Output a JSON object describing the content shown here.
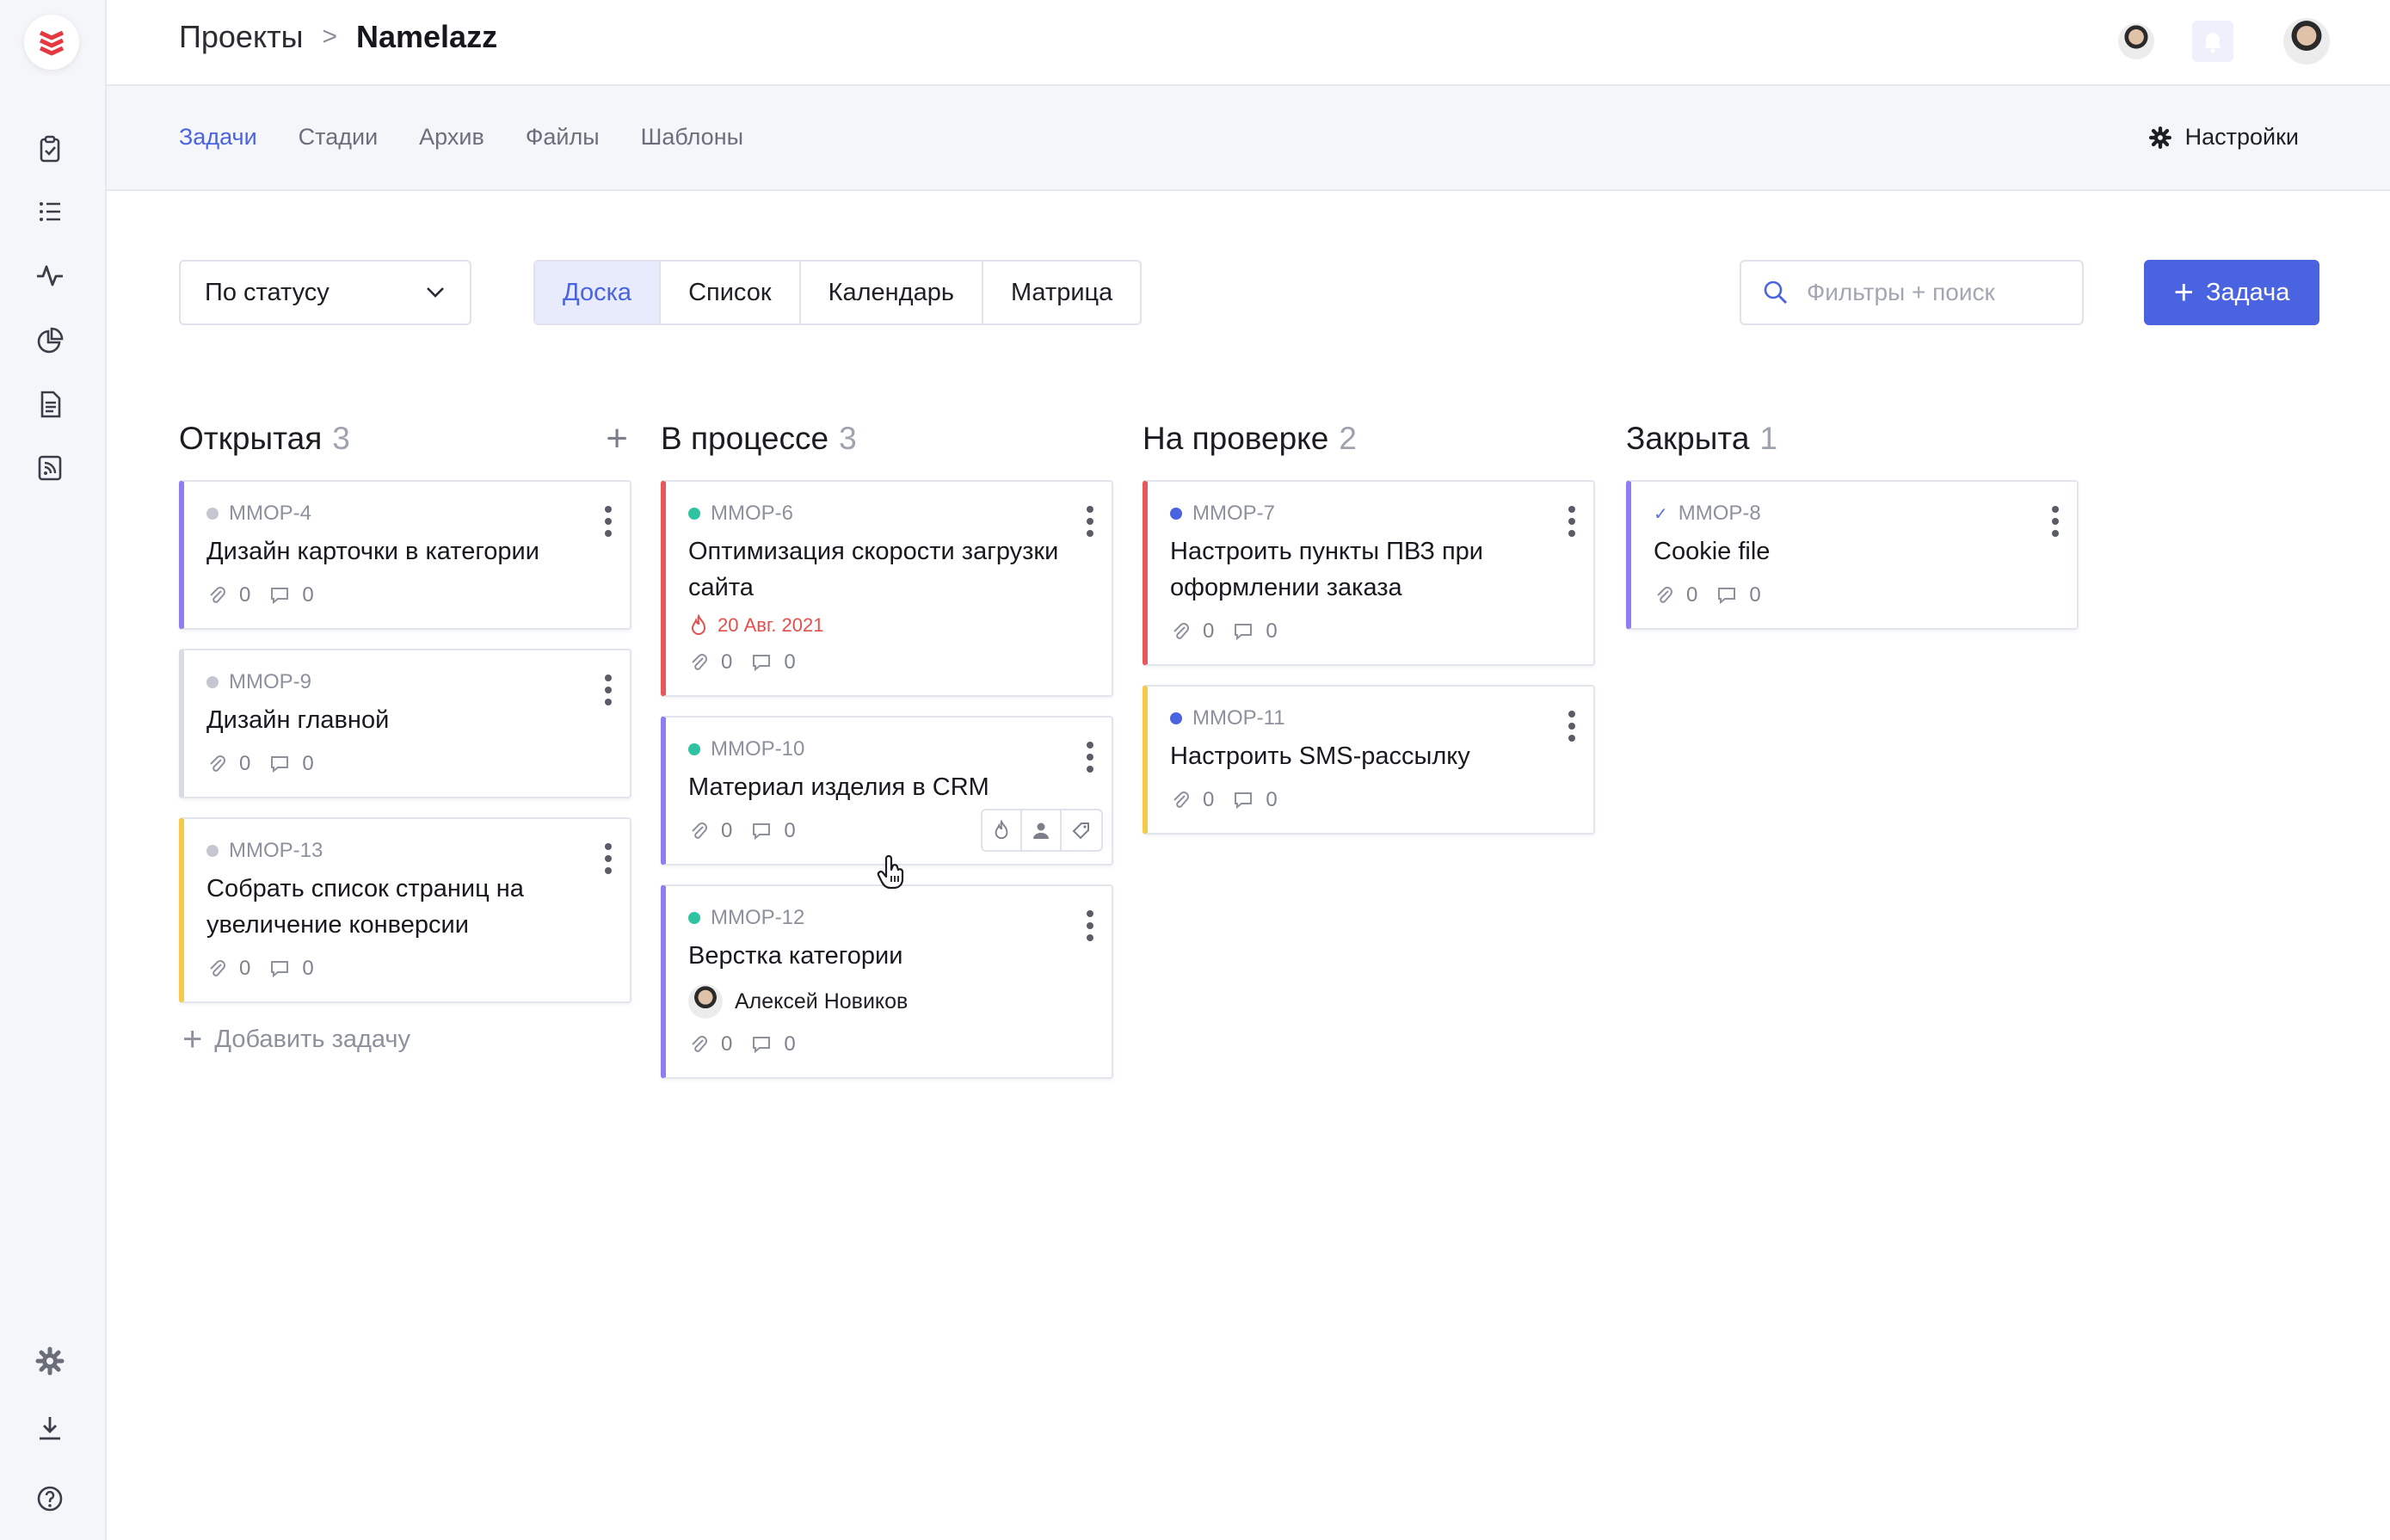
{
  "header": {
    "breadcrumb_root": "Проекты",
    "breadcrumb_separator": ">",
    "project_name": "Namelazz"
  },
  "subnav": {
    "tabs": [
      {
        "label": "Задачи",
        "active": true
      },
      {
        "label": "Стадии",
        "active": false
      },
      {
        "label": "Архив",
        "active": false
      },
      {
        "label": "Файлы",
        "active": false
      },
      {
        "label": "Шаблоны",
        "active": false
      }
    ],
    "settings_label": "Настройки"
  },
  "sidebar": {
    "icons": [
      "tasks-clipboard-icon",
      "list-icon",
      "activity-icon",
      "reports-pie-icon",
      "document-icon",
      "feed-icon",
      "settings-gear-icon",
      "download-icon",
      "help-icon"
    ]
  },
  "toolbar": {
    "group_select": "По статусу",
    "views": [
      {
        "label": "Доска",
        "active": true
      },
      {
        "label": "Список",
        "active": false
      },
      {
        "label": "Календарь",
        "active": false
      },
      {
        "label": "Матрица",
        "active": false
      }
    ],
    "search_placeholder": "Фильтры + поиск",
    "add_task_label": "Задача"
  },
  "colors": {
    "accent": "#4a63e0",
    "purple": "#8e7ff0",
    "red": "#e8585a",
    "yellow": "#f5c949",
    "gray_border": "#d9dbe2",
    "dot_gray": "#c4c7cf",
    "dot_teal": "#2fc3a1",
    "dot_blue": "#4a63e0"
  },
  "board": {
    "columns": [
      {
        "title": "Открытая",
        "count": "3",
        "show_add": true,
        "add_task_label": "Добавить задачу",
        "cards": [
          {
            "id": "MMOP-4",
            "title": "Дизайн карточки в категории",
            "border": "#8e7ff0",
            "dot": "#c4c7cf",
            "attachments": "0",
            "comments": "0"
          },
          {
            "id": "MMOP-9",
            "title": "Дизайн главной",
            "border": "#d9dbe2",
            "dot": "#c4c7cf",
            "attachments": "0",
            "comments": "0"
          },
          {
            "id": "MMOP-13",
            "title": "Собрать список страниц на увеличение конверсии",
            "border": "#f5c949",
            "dot": "#c4c7cf",
            "attachments": "0",
            "comments": "0"
          }
        ]
      },
      {
        "title": "В процессе",
        "count": "3",
        "cards": [
          {
            "id": "MMOP-6",
            "title": "Оптимизация скорости загрузки сайта",
            "border": "#e8585a",
            "dot": "#2fc3a1",
            "due": "20 Авг. 2021",
            "attachments": "0",
            "comments": "0"
          },
          {
            "id": "MMOP-10",
            "title": "Материал изделия в CRM",
            "border": "#8e7ff0",
            "dot": "#2fc3a1",
            "attachments": "0",
            "comments": "0",
            "quick_actions": true
          },
          {
            "id": "MMOP-12",
            "title": "Верстка категории",
            "border": "#8e7ff0",
            "dot": "#2fc3a1",
            "assignee": "Алексей Новиков",
            "attachments": "0",
            "comments": "0"
          }
        ]
      },
      {
        "title": "На проверке",
        "count": "2",
        "cards": [
          {
            "id": "MMOP-7",
            "title": "Настроить пункты ПВЗ при оформлении заказа",
            "border": "#e8585a",
            "dot": "#4a63e0",
            "attachments": "0",
            "comments": "0"
          },
          {
            "id": "MMOP-11",
            "title": "Настроить SMS-рассылку",
            "border": "#f5c949",
            "dot": "#4a63e0",
            "attachments": "0",
            "comments": "0"
          }
        ]
      },
      {
        "title": "Закрыта",
        "count": "1",
        "cards": [
          {
            "id": "MMOP-8",
            "title": "Cookie file",
            "border": "#8e7ff0",
            "done": true,
            "attachments": "0",
            "comments": "0"
          }
        ]
      }
    ]
  }
}
